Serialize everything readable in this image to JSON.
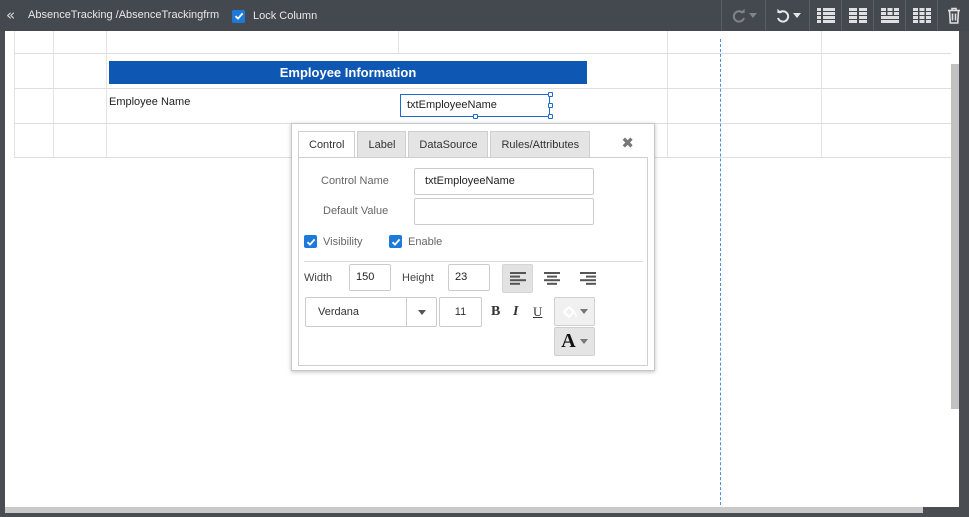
{
  "toolbar": {
    "breadcrumb": "AbsenceTracking /AbsenceTrackingfrm",
    "lock_column_label": "Lock Column",
    "lock_column_checked": true,
    "icons": [
      "back-icon",
      "redo-icon",
      "undo-icon",
      "grid-layout-icon",
      "grid-layout-icon",
      "grid-layout-icon",
      "grid-layout-icon",
      "trash-icon"
    ]
  },
  "form": {
    "section_title": "Employee Information",
    "employee_name_label": "Employee Name",
    "employee_name_control": "txtEmployeeName"
  },
  "popup": {
    "tabs": [
      {
        "label": "Control",
        "active": true
      },
      {
        "label": "Label",
        "active": false
      },
      {
        "label": "DataSource",
        "active": false
      },
      {
        "label": "Rules/Attributes",
        "active": false
      }
    ],
    "control_name_label": "Control Name",
    "control_name_value": "txtEmployeeName",
    "default_value_label": "Default Value",
    "default_value": "",
    "visibility_label": "Visibility",
    "visibility_checked": true,
    "enable_label": "Enable",
    "enable_checked": true,
    "width_label": "Width",
    "width_value": "150",
    "height_label": "Height",
    "height_value": "23",
    "alignment": "left",
    "font_family": "Verdana",
    "font_size": "11",
    "bold_label": "B",
    "italic_label": "I",
    "underline_label": "U",
    "font_color_label": "A"
  },
  "colors": {
    "toolbar_bg": "#444950",
    "title_bar_bg": "#0e57b3",
    "accent": "#1e7ad9",
    "guide": "#4a8fe0"
  }
}
